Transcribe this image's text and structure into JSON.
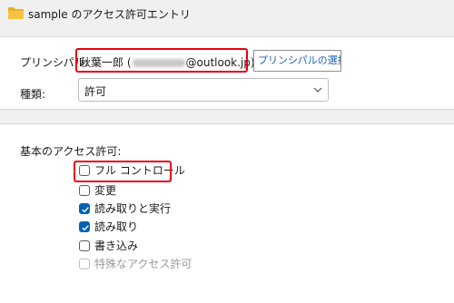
{
  "window": {
    "title": "sample のアクセス許可エントリ"
  },
  "principal": {
    "label": "プリンシパル:",
    "name": "秋葉一郎 (",
    "email_domain": "@outlook.jp)",
    "select_button_label": "プリンシパルの選択"
  },
  "type": {
    "label": "種類:",
    "selected": "許可"
  },
  "permissions": {
    "heading": "基本のアクセス許可:",
    "items": [
      {
        "label": "フル コントロール",
        "checked": false,
        "disabled": false
      },
      {
        "label": "変更",
        "checked": false,
        "disabled": false
      },
      {
        "label": "読み取りと実行",
        "checked": true,
        "disabled": false
      },
      {
        "label": "読み取り",
        "checked": true,
        "disabled": false
      },
      {
        "label": "書き込み",
        "checked": false,
        "disabled": false
      },
      {
        "label": "特殊なアクセス許可",
        "checked": false,
        "disabled": true
      }
    ]
  },
  "colors": {
    "highlight": "#e60012",
    "checkbox_checked": "#0063b1",
    "link": "#1a5fb4",
    "folder": "#f5c342"
  }
}
